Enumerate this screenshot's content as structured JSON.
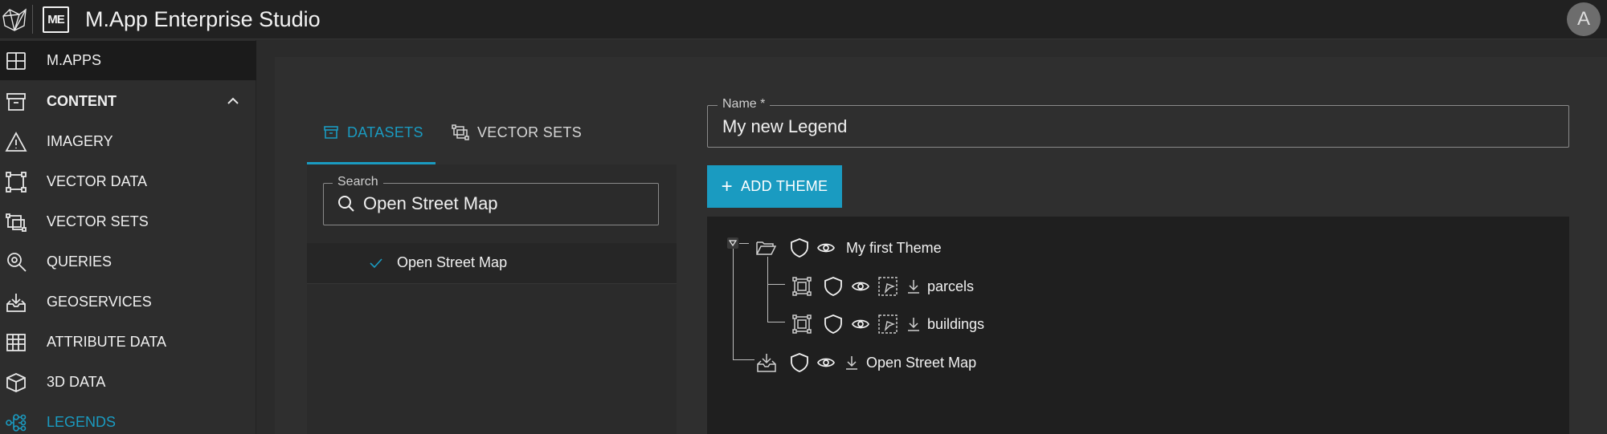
{
  "app": {
    "title": "M.App Enterprise Studio",
    "logo_text": "ME",
    "avatar_letter": "A"
  },
  "sidebar": {
    "items": [
      {
        "label": "M.APPS",
        "icon": "grid-icon"
      },
      {
        "label": "CONTENT",
        "icon": "archive-box-icon"
      },
      {
        "label": "IMAGERY",
        "icon": "warning-triangle-icon"
      },
      {
        "label": "VECTOR DATA",
        "icon": "vector-square-icon"
      },
      {
        "label": "VECTOR SETS",
        "icon": "vector-set-icon"
      },
      {
        "label": "QUERIES",
        "icon": "query-search-icon"
      },
      {
        "label": "GEOSERVICES",
        "icon": "download-tray-icon"
      },
      {
        "label": "ATTRIBUTE DATA",
        "icon": "table-icon"
      },
      {
        "label": "3D DATA",
        "icon": "cube-icon"
      },
      {
        "label": "LEGENDS",
        "icon": "legend-tree-icon"
      }
    ]
  },
  "tabs": {
    "datasets": "DATASETS",
    "vector_sets": "VECTOR SETS"
  },
  "search": {
    "label": "Search",
    "value": "Open Street Map"
  },
  "results": [
    {
      "label": "Open Street Map",
      "checked": true
    }
  ],
  "form": {
    "name_label": "Name *",
    "name_value": "My new Legend"
  },
  "add_theme_button": {
    "label": "ADD THEME"
  },
  "legend_tree": {
    "theme": "My first Theme",
    "children": [
      "parcels",
      "buildings"
    ],
    "dataset": "Open Street Map"
  },
  "colors": {
    "accent": "#1a9bc1",
    "topbar": "#212121",
    "sidebar": "#2d2d2d",
    "tree_bg": "#1f1f1f"
  }
}
